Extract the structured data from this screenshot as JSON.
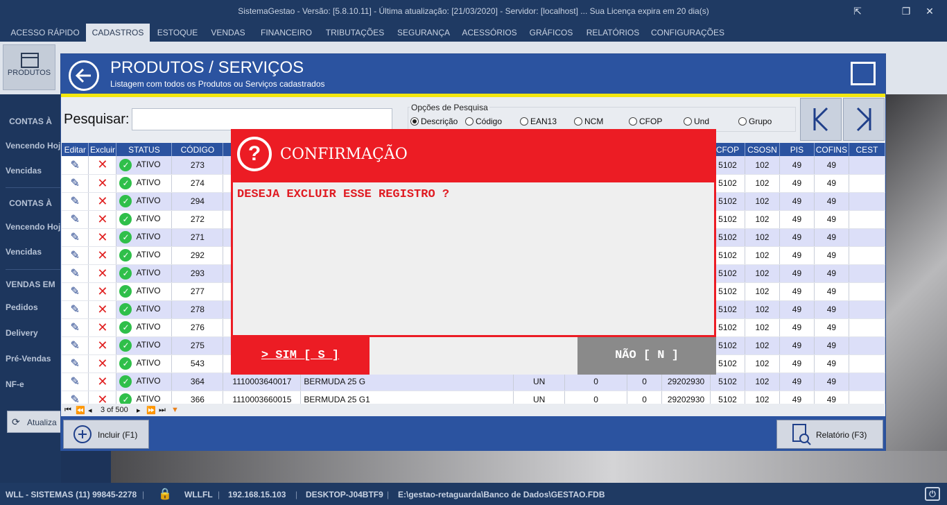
{
  "app": {
    "title": "SistemaGestao - Versão: [5.8.10.11] - Última atualização: [21/03/2020] - Servidor: [localhost] ... Sua Licença expira em 20 dia(s)"
  },
  "menu": [
    "ACESSO RÁPIDO",
    "CADASTROS",
    "ESTOQUE",
    "VENDAS",
    "FINANCEIRO",
    "TRIBUTAÇÕES",
    "SEGURANÇA",
    "ACESSÓRIOS",
    "GRÁFICOS",
    "RELATÓRIOS",
    "CONFIGURAÇÕES"
  ],
  "ribbon": {
    "produtos_label": "PRODUTOS"
  },
  "sidebar": {
    "head1": "CONTAS À",
    "item1": "Vencendo Hoj",
    "item2": "Vencidas",
    "head2": "CONTAS À",
    "item3": "Vencendo Hoj",
    "item4": "Vencidas",
    "head3": "VENDAS EM",
    "item5": "Pedidos",
    "item6": "Delivery",
    "item7": "Pré-Vendas",
    "item8": "NF-e",
    "refresh": "Atualiza"
  },
  "window": {
    "title": "PRODUTOS / SERVIÇOS",
    "subtitle": "Listagem com todos os Produtos ou Serviços cadastrados",
    "search_label": "Pesquisar:",
    "search_value": "",
    "options_title": "Opções de Pesquisa",
    "options": [
      "Descrição",
      "Código",
      "EAN13",
      "NCM",
      "CFOP",
      "Und",
      "Grupo"
    ],
    "selected_option": "Descrição"
  },
  "grid": {
    "headers": [
      "Editar",
      "Excluir",
      "STATUS",
      "CÓDIGO",
      "",
      "",
      "",
      "",
      "",
      "",
      "CFOP",
      "CSOSN",
      "PIS",
      "COFINS",
      "CEST"
    ],
    "rows": [
      {
        "status": "ATIVO",
        "codigo": "273",
        "ean": "",
        "desc": "",
        "und": "",
        "q1": "",
        "q2": "",
        "ncm": "",
        "cfop": "5102",
        "csosn": "102",
        "pis": "49",
        "cofins": "49"
      },
      {
        "status": "ATIVO",
        "codigo": "274",
        "ean": "",
        "desc": "",
        "und": "",
        "q1": "",
        "q2": "",
        "ncm": "",
        "cfop": "5102",
        "csosn": "102",
        "pis": "49",
        "cofins": "49"
      },
      {
        "status": "ATIVO",
        "codigo": "294",
        "ean": "",
        "desc": "",
        "und": "",
        "q1": "",
        "q2": "",
        "ncm": "",
        "cfop": "5102",
        "csosn": "102",
        "pis": "49",
        "cofins": "49"
      },
      {
        "status": "ATIVO",
        "codigo": "272",
        "ean": "",
        "desc": "",
        "und": "",
        "q1": "",
        "q2": "",
        "ncm": "",
        "cfop": "5102",
        "csosn": "102",
        "pis": "49",
        "cofins": "49"
      },
      {
        "status": "ATIVO",
        "codigo": "271",
        "ean": "",
        "desc": "",
        "und": "",
        "q1": "",
        "q2": "",
        "ncm": "",
        "cfop": "5102",
        "csosn": "102",
        "pis": "49",
        "cofins": "49"
      },
      {
        "status": "ATIVO",
        "codigo": "292",
        "ean": "",
        "desc": "",
        "und": "",
        "q1": "",
        "q2": "",
        "ncm": "",
        "cfop": "5102",
        "csosn": "102",
        "pis": "49",
        "cofins": "49"
      },
      {
        "status": "ATIVO",
        "codigo": "293",
        "ean": "",
        "desc": "",
        "und": "",
        "q1": "",
        "q2": "",
        "ncm": "",
        "cfop": "5102",
        "csosn": "102",
        "pis": "49",
        "cofins": "49"
      },
      {
        "status": "ATIVO",
        "codigo": "277",
        "ean": "",
        "desc": "",
        "und": "",
        "q1": "",
        "q2": "",
        "ncm": "",
        "cfop": "5102",
        "csosn": "102",
        "pis": "49",
        "cofins": "49"
      },
      {
        "status": "ATIVO",
        "codigo": "278",
        "ean": "",
        "desc": "",
        "und": "",
        "q1": "",
        "q2": "",
        "ncm": "",
        "cfop": "5102",
        "csosn": "102",
        "pis": "49",
        "cofins": "49"
      },
      {
        "status": "ATIVO",
        "codigo": "276",
        "ean": "",
        "desc": "",
        "und": "",
        "q1": "",
        "q2": "",
        "ncm": "",
        "cfop": "5102",
        "csosn": "102",
        "pis": "49",
        "cofins": "49"
      },
      {
        "status": "ATIVO",
        "codigo": "275",
        "ean": "",
        "desc": "",
        "und": "",
        "q1": "",
        "q2": "",
        "ncm": "",
        "cfop": "5102",
        "csosn": "102",
        "pis": "49",
        "cofins": "49"
      },
      {
        "status": "ATIVO",
        "codigo": "543",
        "ean": "",
        "desc": "",
        "und": "",
        "q1": "",
        "q2": "",
        "ncm": "",
        "cfop": "5102",
        "csosn": "102",
        "pis": "49",
        "cofins": "49"
      },
      {
        "status": "ATIVO",
        "codigo": "364",
        "ean": "1110003640017",
        "desc": "BERMUDA 25 G",
        "und": "UN",
        "q1": "0",
        "q2": "0",
        "ncm": "29202930",
        "cfop": "5102",
        "csosn": "102",
        "pis": "49",
        "cofins": "49"
      },
      {
        "status": "ATIVO",
        "codigo": "366",
        "ean": "1110003660015",
        "desc": "BERMUDA 25 G1",
        "und": "UN",
        "q1": "0",
        "q2": "0",
        "ncm": "29202930",
        "cfop": "5102",
        "csosn": "102",
        "pis": "49",
        "cofins": "49"
      }
    ]
  },
  "pager": {
    "text": "3 of 500"
  },
  "footer": {
    "add_label": "Incluir (F1)",
    "report_label": "Relatório (F3)"
  },
  "dialog": {
    "title": "CONFIRMAÇÃO",
    "message": "DESEJA EXCLUIR ESSE REGISTRO ?",
    "yes_label": "> SIM [ S ]",
    "no_label": "NÃO [ N ]"
  },
  "statusbar": {
    "company": "WLL - SISTEMAS (11) 99845-2278",
    "user": "WLLFL",
    "ip": "192.168.15.103",
    "host": "DESKTOP-J04BTF9",
    "db": "E:\\gestao-retaguarda\\Banco de Dados\\GESTAO.FDB"
  }
}
